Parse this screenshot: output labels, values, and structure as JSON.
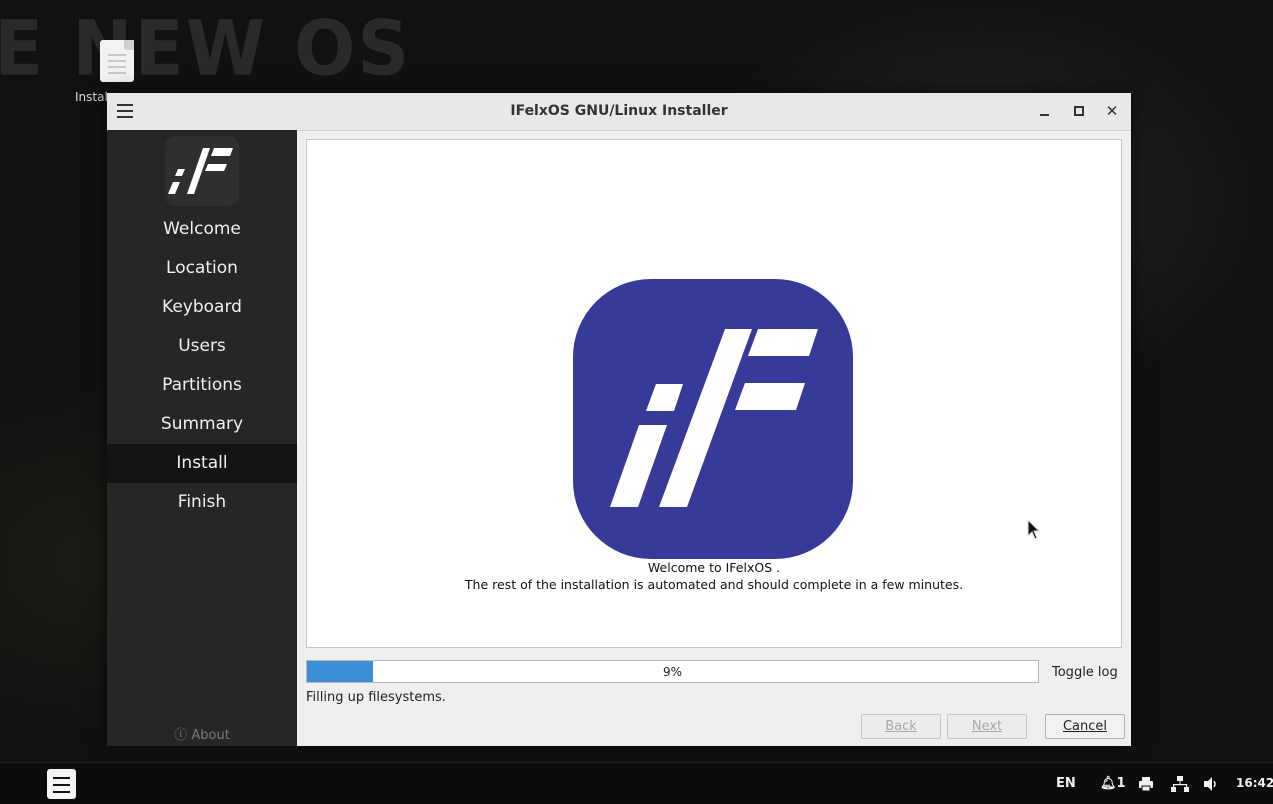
{
  "desktop": {
    "wallpaper_text": "E NEW OS",
    "icon_label": "Instal"
  },
  "window": {
    "title": "IFelxOS GNU/Linux Installer"
  },
  "sidebar": {
    "steps": [
      {
        "label": "Welcome"
      },
      {
        "label": "Location"
      },
      {
        "label": "Keyboard"
      },
      {
        "label": "Users"
      },
      {
        "label": "Partitions"
      },
      {
        "label": "Summary"
      },
      {
        "label": "Install",
        "active": true
      },
      {
        "label": "Finish"
      }
    ],
    "about_label": "About"
  },
  "slide": {
    "title": "Welcome to IFelxOS .",
    "body": "The rest of the installation is automated and should complete in a few minutes."
  },
  "progress": {
    "value": 9,
    "text": "9%",
    "status": "Filling up filesystems."
  },
  "toggle_log_label": "Toggle log",
  "buttons": {
    "back": "Back",
    "next": "Next",
    "cancel": "Cancel"
  },
  "taskbar": {
    "language": "EN",
    "notifications_count": "1",
    "clock": "16:42"
  },
  "colors": {
    "brand_logo": "#383a99",
    "progress_fill": "#3a8fd6",
    "sidebar_bg": "#262626",
    "sidebar_active_bg": "#141414"
  }
}
